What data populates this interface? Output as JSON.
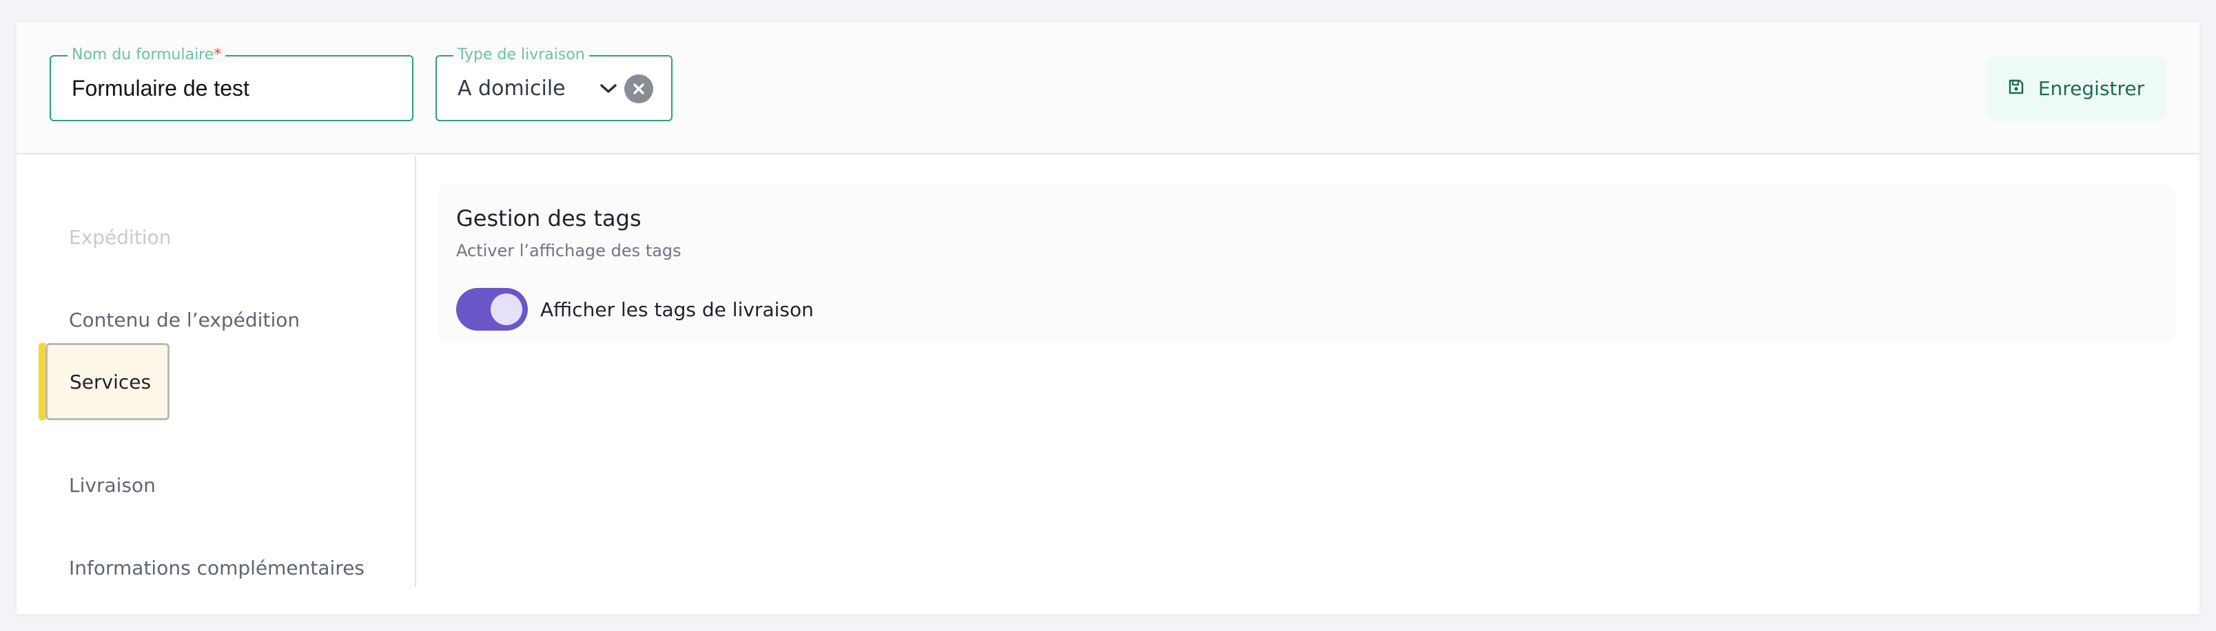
{
  "form": {
    "name_field": {
      "legend": "Nom du formulaire",
      "required_mark": "*",
      "value": "Formulaire de test"
    },
    "type_field": {
      "legend": "Type de livraison",
      "value": "A domicile"
    },
    "save_label": "Enregistrer"
  },
  "sidebar": {
    "items": [
      {
        "label": "Expédition",
        "state": "disabled"
      },
      {
        "label": "Contenu de l’expédition",
        "state": "normal"
      },
      {
        "label": "Services",
        "state": "active"
      },
      {
        "label": "Livraison",
        "state": "normal"
      },
      {
        "label": "Informations complémentaires",
        "state": "normal"
      }
    ]
  },
  "panel": {
    "title": "Gestion des tags",
    "subtitle": "Activer l’affichage des tags",
    "toggle": {
      "label": "Afficher les tags de livraison",
      "checked": true
    }
  },
  "icons": {
    "chevron": "chevron-down-icon",
    "clear": "clear-icon",
    "save": "floppy-disk-icon"
  },
  "colors": {
    "accent_green": "#2f9e7c",
    "toggle_purple": "#6a56c9",
    "active_nav_marker": "#f5d63a",
    "active_nav_bg": "#fff7e8",
    "save_bg": "#eefaf6"
  }
}
